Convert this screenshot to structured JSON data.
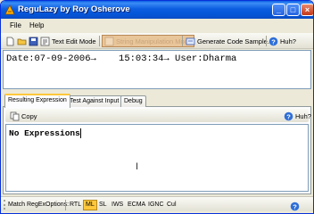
{
  "window": {
    "title": "ReguLazy by Roy Osherove"
  },
  "menu": {
    "items": [
      "File",
      "Help"
    ]
  },
  "toolbar": {
    "text_edit_mode": "Text Edit Mode",
    "string_manipulation_mode": "String Manipulation Mode",
    "generate_code": "Generate Code Sample...",
    "help": "Huh?"
  },
  "input": {
    "text": "Date:07-09-2006→    15:03:34→ User:Dharma"
  },
  "tabs": [
    "Resulting Expression",
    "Test Against Input",
    "Debug"
  ],
  "result_toolbar": {
    "copy": "Copy",
    "help": "Huh?"
  },
  "result": {
    "text": "No Expressions"
  },
  "options": {
    "label": "Match RegExOptions:",
    "items": [
      "RTL",
      "ML",
      "SL",
      "IWS",
      "ECMA",
      "IGNC",
      "Cul"
    ],
    "active": "ML"
  },
  "colors": {
    "title_bar": "#0554d6",
    "highlight": "#ffc83c"
  },
  "icons": [
    "app-icon",
    "new-icon",
    "open-icon",
    "save-icon",
    "text-edit-icon",
    "string-mode-icon",
    "generate-code-icon",
    "help-icon",
    "copy-icon"
  ]
}
